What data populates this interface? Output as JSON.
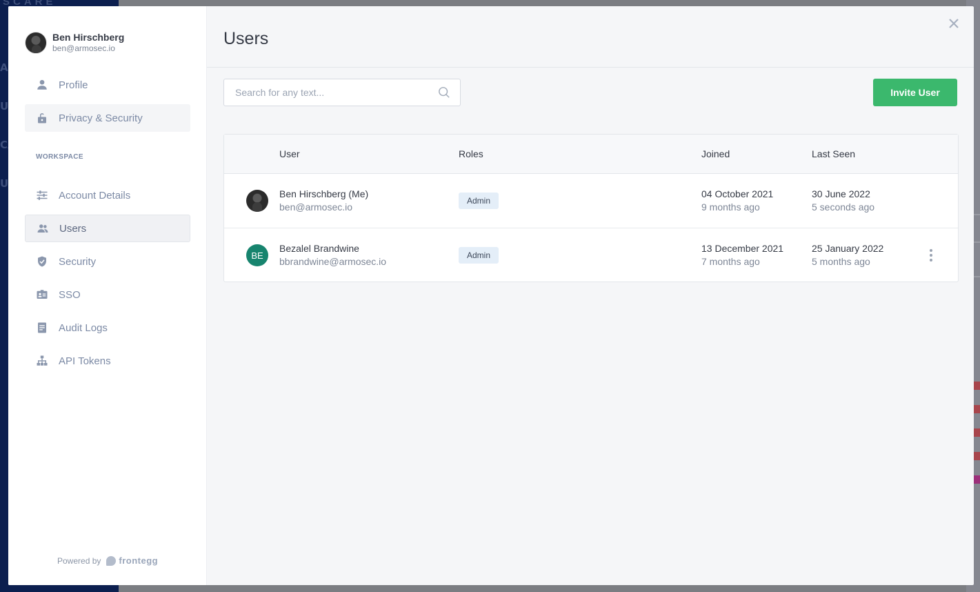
{
  "backdrop": {
    "top_text": "SCARE",
    "left_fragments": [
      "AL",
      "UR",
      "CA",
      "U"
    ]
  },
  "profile": {
    "name": "Ben Hirschberg",
    "email": "ben@armosec.io"
  },
  "sidebar": {
    "account_items": [
      {
        "label": "Profile",
        "icon": "person-icon"
      },
      {
        "label": "Privacy & Security",
        "icon": "lock-icon"
      }
    ],
    "section_label": "WORKSPACE",
    "workspace_items": [
      {
        "label": "Account Details",
        "icon": "sliders-icon"
      },
      {
        "label": "Users",
        "icon": "users-icon"
      },
      {
        "label": "Security",
        "icon": "shield-icon"
      },
      {
        "label": "SSO",
        "icon": "id-card-icon"
      },
      {
        "label": "Audit Logs",
        "icon": "document-icon"
      },
      {
        "label": "API Tokens",
        "icon": "hierarchy-icon"
      }
    ],
    "powered_by": "Powered by",
    "brand": "frontegg"
  },
  "main": {
    "title": "Users",
    "search_placeholder": "Search for any text...",
    "invite_label": "Invite User",
    "columns": [
      "User",
      "Roles",
      "Joined",
      "Last Seen"
    ],
    "users": [
      {
        "name": "Ben Hirschberg (Me)",
        "email": "ben@armosec.io",
        "avatar": "photo",
        "initials": "",
        "role": "Admin",
        "joined": "04 October 2021",
        "joined_ago": "9 months ago",
        "last_seen": "30 June 2022",
        "last_seen_ago": "5 seconds ago"
      },
      {
        "name": "Bezalel Brandwine",
        "email": "bbrandwine@armosec.io",
        "avatar": "initials",
        "initials": "BE",
        "role": "Admin",
        "joined": "13 December 2021",
        "joined_ago": "7 months ago",
        "last_seen": "25 January 2022",
        "last_seen_ago": "5 months ago"
      }
    ]
  },
  "colors": {
    "accent_green": "#3bb86d",
    "initials_avatar": "#17846e",
    "backdrop_navy": "#0c1f4f"
  }
}
